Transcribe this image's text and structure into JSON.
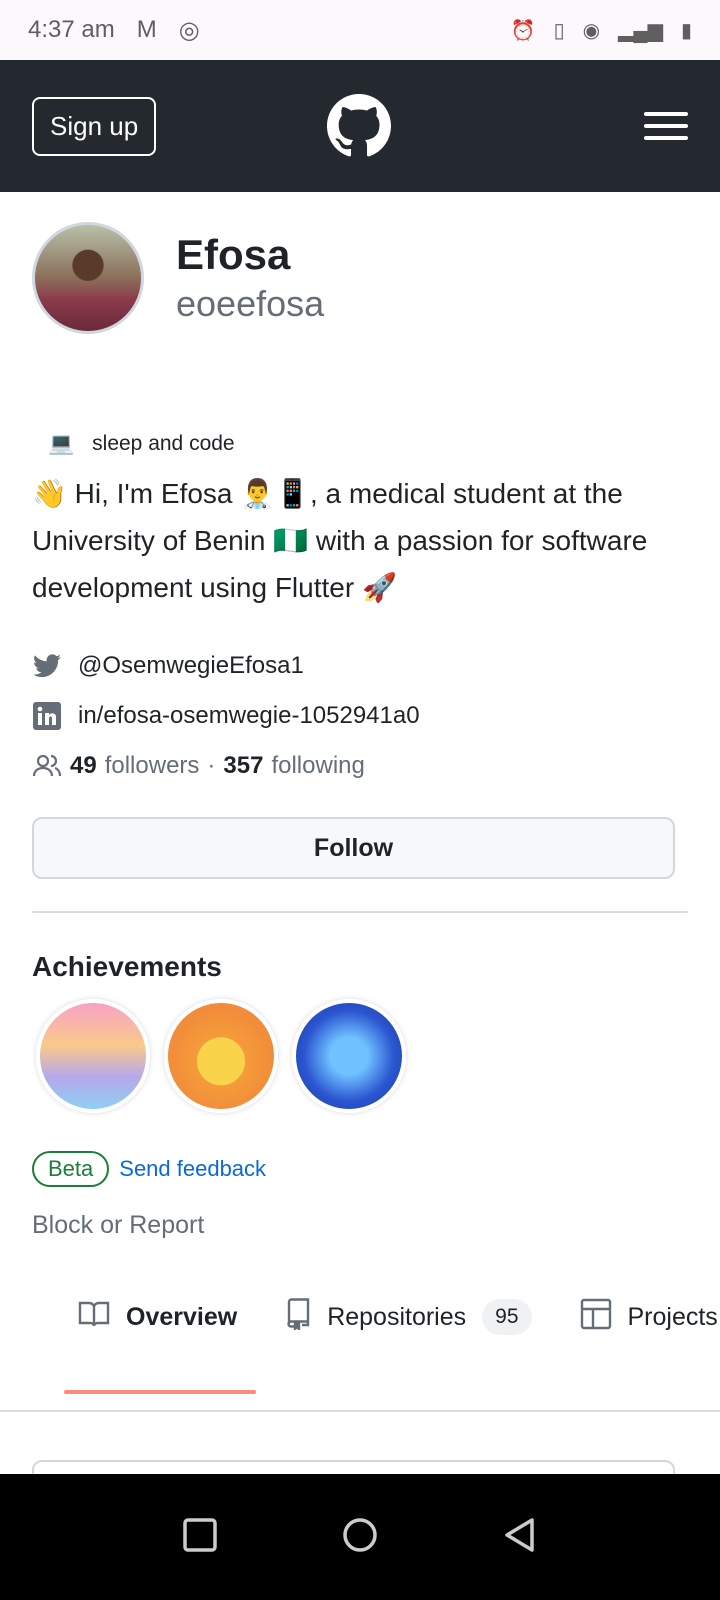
{
  "status_bar": {
    "time": "4:37 am"
  },
  "header": {
    "signup_label": "Sign up"
  },
  "profile": {
    "name": "Efosa",
    "login": "eoeefosa",
    "status_emoji": "💻",
    "status_text": "sleep and code",
    "bio": "👋 Hi, I'm Efosa 👨‍⚕️📱, a medical student at the University of Benin 🇳🇬 with a passion for software development using Flutter 🚀",
    "twitter": "@OsemwegieEfosa1",
    "linkedin": "in/efosa-osemwegie-1052941a0",
    "followers_count": "49",
    "followers_label": "followers",
    "separator": "·",
    "following_count": "357",
    "following_label": "following",
    "follow_label": "Follow"
  },
  "achievements": {
    "title": "Achievements",
    "beta_label": "Beta",
    "feedback_label": "Send feedback"
  },
  "block_label": "Block or Report",
  "tabs": [
    {
      "label": "Overview"
    },
    {
      "label": "Repositories",
      "count": "95"
    },
    {
      "label": "Projects"
    }
  ],
  "colors": {
    "header": "#24292f",
    "accent": "#fd8c73",
    "link": "#0969da",
    "beta": "#1a7f37"
  }
}
